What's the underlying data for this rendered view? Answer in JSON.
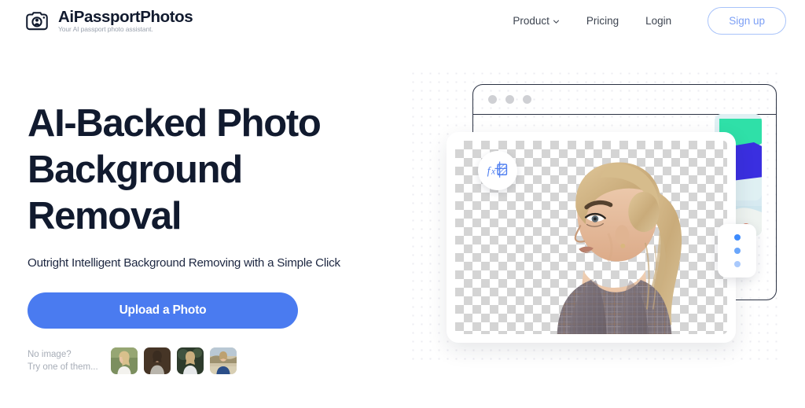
{
  "brand": {
    "name": "AiPassportPhotos",
    "tagline": "Your AI passport photo assistant.",
    "icon": "camera-icon",
    "color": "#111a2e"
  },
  "nav": {
    "items": [
      {
        "label": "Product",
        "has_dropdown": true,
        "icon": "chevron-down-icon"
      },
      {
        "label": "Pricing",
        "has_dropdown": false
      },
      {
        "label": "Login",
        "has_dropdown": false
      }
    ],
    "signup_label": "Sign up",
    "signup_border_color": "#a8c3fa",
    "signup_text_color": "#7c9ff5"
  },
  "hero": {
    "headline": "AI-Backed Photo Background Removal",
    "subhead": "Outright Intelligent Background Removing with a Simple Click",
    "cta_label": "Upload a Photo",
    "cta_color": "#4a7bf0",
    "samples_label": "No image?\nTry one of them...",
    "samples_label_line1": "No image?",
    "samples_label_line2": "Try one of them...",
    "samples": [
      {
        "name": "sample-blonde-outdoor",
        "bg": "#7c8f5f",
        "skin": "#e8c4a4",
        "top": "#f3f2ee",
        "hair": "#d8c08c"
      },
      {
        "name": "sample-grey-top-dark",
        "bg": "#463526",
        "skin": "#e3b896",
        "top": "#b9b5ac",
        "hair": "#3a2c20"
      },
      {
        "name": "sample-foliage-dark",
        "bg": "#2d3b2c",
        "skin": "#edc9ab",
        "top": "#e6e8ea",
        "hair": "#c9ae7e"
      },
      {
        "name": "sample-man-landscape",
        "bg": "#cfc4a8",
        "skin": "#e8c0a0",
        "top": "#2b4e88",
        "hair": "#bda171"
      }
    ]
  },
  "illustration": {
    "browser_dots_color": "#cfd0d4",
    "browser_border_color": "#2b3243",
    "fx_badge_icon": "fx-formula-icon",
    "fx_badge_color": "#4a7bf0",
    "dots_menu_icon": "three-dots-vertical-icon",
    "dots_menu_colors": [
      "#3d8bfd",
      "#6aa6fb",
      "#a9c9fc"
    ],
    "shape_card_colors": [
      "#2fe0a8",
      "#3a2fe0"
    ],
    "portrait_alt": "woman-with-blonde-ponytail-portrait",
    "checker_color": "#d4d4d4"
  }
}
